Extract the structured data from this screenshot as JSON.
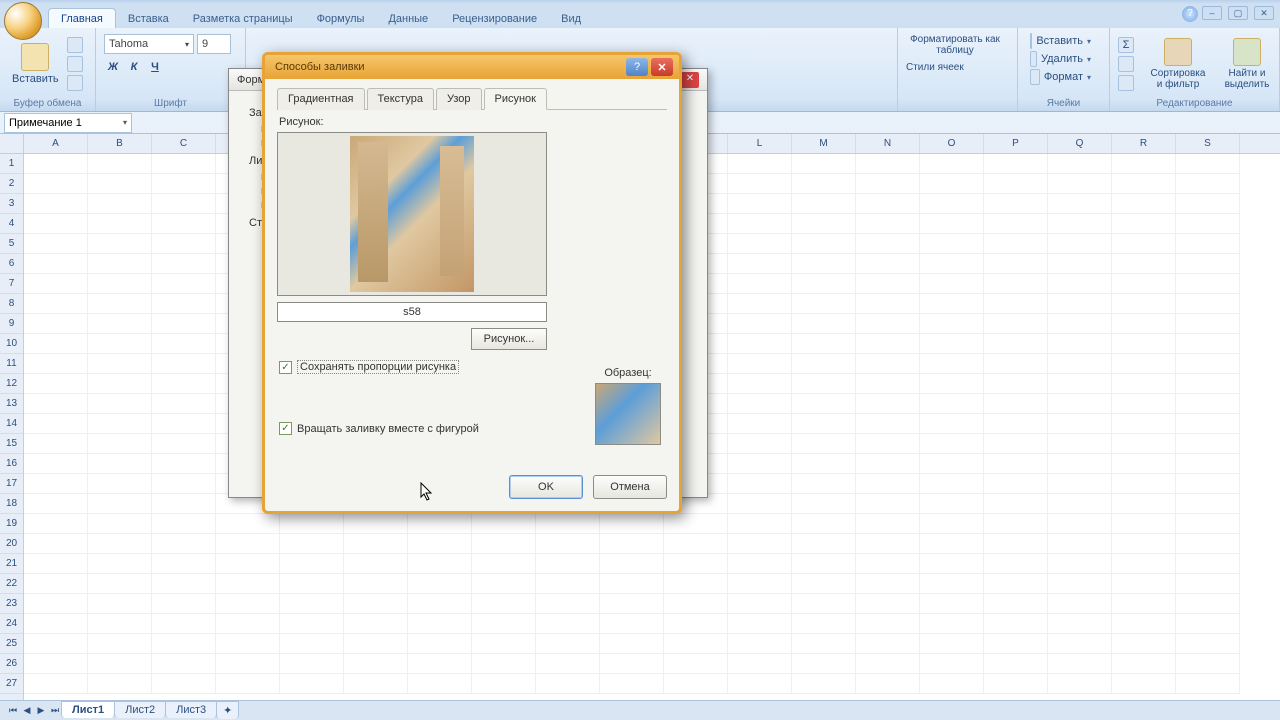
{
  "ribbon": {
    "tabs": [
      "Главная",
      "Вставка",
      "Разметка страницы",
      "Формулы",
      "Данные",
      "Рецензирование",
      "Вид"
    ],
    "active_tab": 0,
    "clipboard": {
      "paste": "Вставить",
      "group": "Буфер обмена"
    },
    "font": {
      "name": "Tahoma",
      "size": "9",
      "group": "Шрифт"
    },
    "cells": {
      "insert": "Вставить",
      "delete": "Удалить",
      "format": "Формат",
      "format_table": "Форматировать как таблицу",
      "styles": "Стили ячеек",
      "group_cells": "Ячейки"
    },
    "editing": {
      "sort": "Сортировка и фильтр",
      "find": "Найти и выделить",
      "group": "Редактирование"
    }
  },
  "name_box": "Примечание 1",
  "columns": [
    "A",
    "B",
    "C",
    "",
    "",
    "",
    "",
    "",
    "",
    "",
    "",
    "L",
    "M",
    "N",
    "O",
    "P",
    "Q",
    "R",
    "S"
  ],
  "rows": 27,
  "sheets": {
    "tabs": [
      "Лист1",
      "Лист2",
      "Лист3"
    ],
    "active": 0
  },
  "back_dialog": {
    "title": "Форм",
    "sections": {
      "s1": "Зал",
      "s1a": "ц",
      "s1b": "п",
      "s2": "Лин",
      "s2a": "ц",
      "s2b": "ш",
      "s2c": "н",
      "s3": "Стр"
    }
  },
  "dialog": {
    "title": "Способы заливки",
    "tabs": [
      "Градиентная",
      "Текстура",
      "Узор",
      "Рисунок"
    ],
    "active_tab": 3,
    "picture_label": "Рисунок:",
    "picture_name": "s58",
    "picture_button": "Рисунок...",
    "chk_aspect": "Сохранять пропорции рисунка",
    "chk_rotate": "Вращать заливку вместе с фигурой",
    "sample_label": "Образец:",
    "ok": "OK",
    "cancel": "Отмена"
  }
}
